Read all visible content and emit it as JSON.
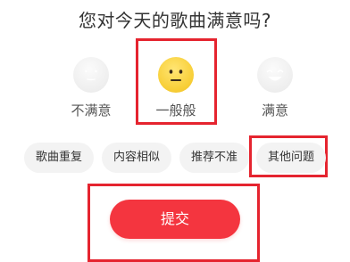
{
  "title": "您对今天的歌曲满意吗?",
  "ratings": [
    {
      "label": "不满意",
      "icon": "neutral-gray-face-icon",
      "selected": false
    },
    {
      "label": "一般般",
      "icon": "neutral-yellow-face-icon",
      "selected": true
    },
    {
      "label": "满意",
      "icon": "smiling-gray-face-icon",
      "selected": false
    }
  ],
  "reasons": [
    {
      "label": "歌曲重复",
      "selected": false
    },
    {
      "label": "内容相似",
      "selected": false
    },
    {
      "label": "推荐不准",
      "selected": false
    },
    {
      "label": "其他问题",
      "selected": true
    }
  ],
  "submit_label": "提交",
  "colors": {
    "accent": "#f4353f",
    "highlight_border": "#e5242f",
    "chip_background": "#f3f3f3",
    "selected_face": "#f8cf38",
    "unselected_face": "#eeeeee"
  }
}
